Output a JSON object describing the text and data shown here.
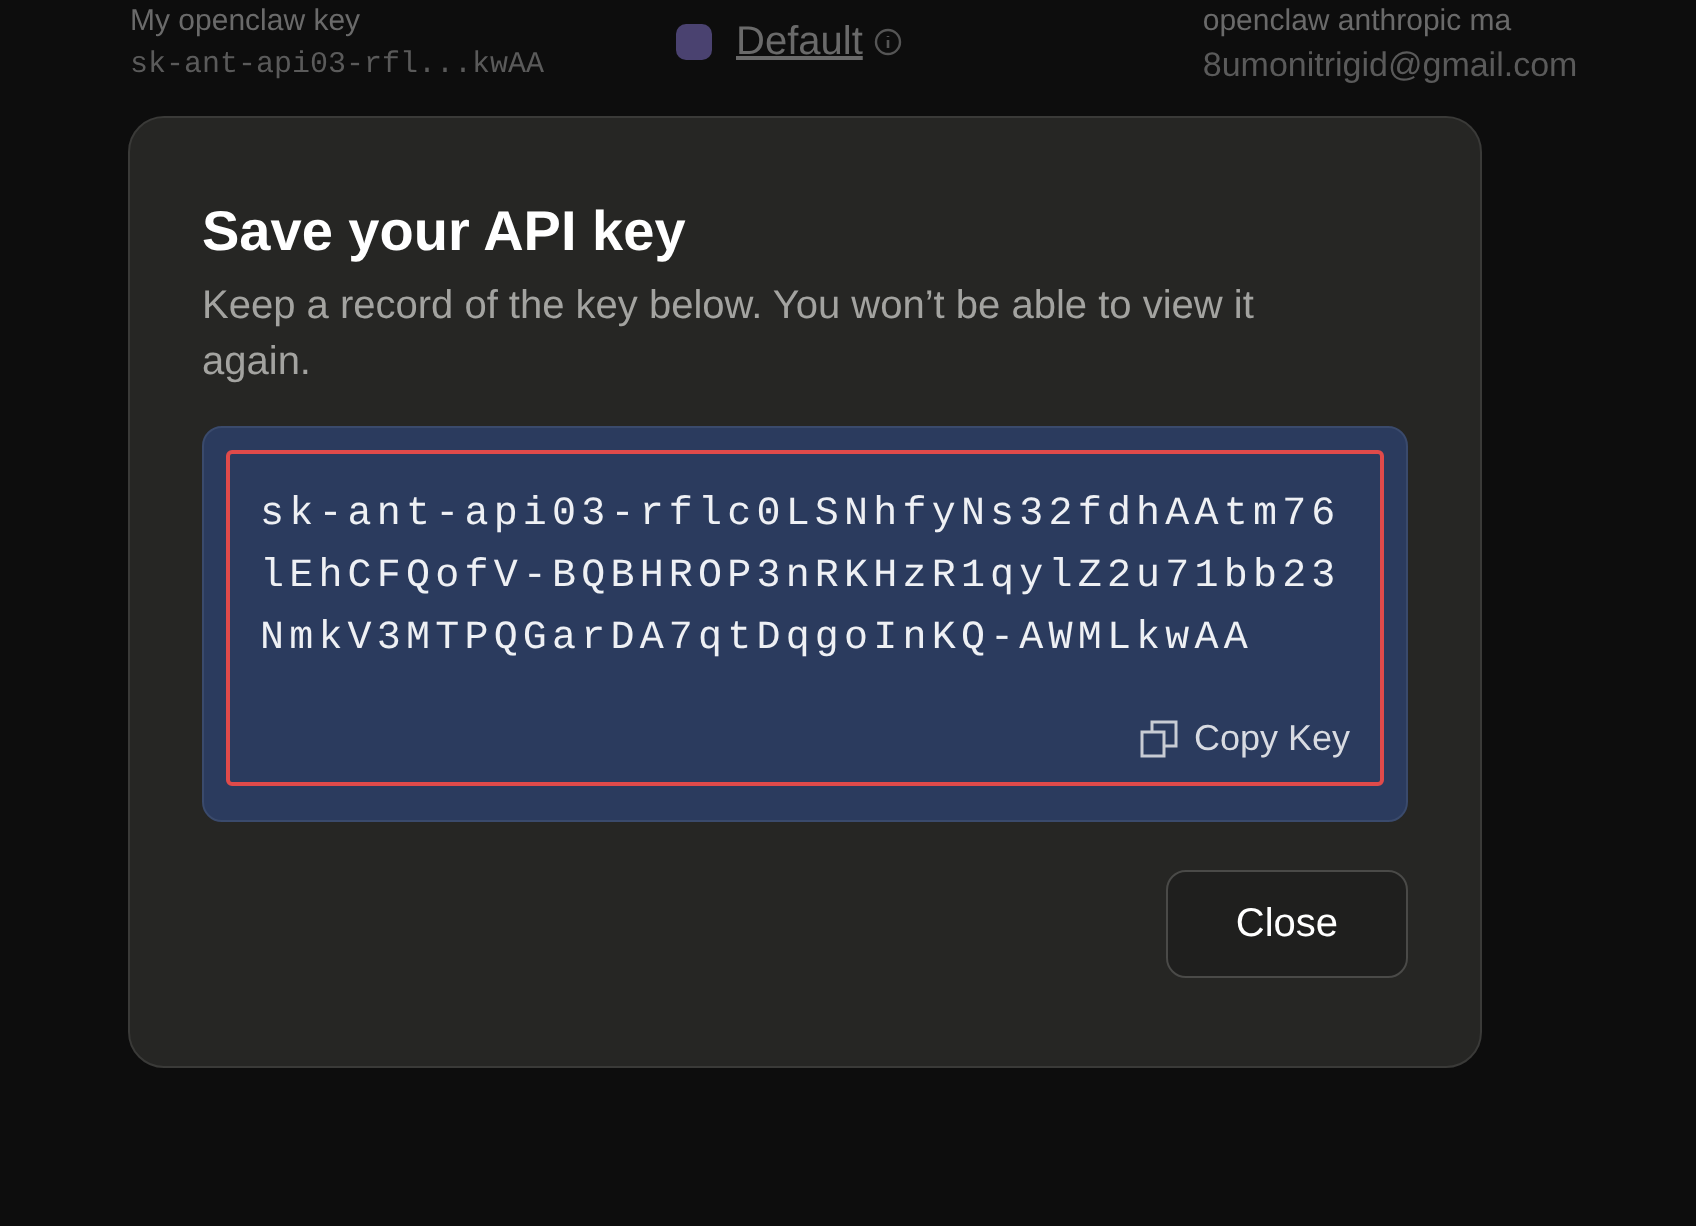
{
  "background_row": {
    "name": "My openclaw key",
    "key": "sk-ant-api03-rfl...kwAA",
    "workspace": "Default",
    "creator_name": "openclaw anthropic ma",
    "creator_email": "8umonitrigid@gmail.com"
  },
  "dialog": {
    "title": "Save your API key",
    "description": "Keep a record of the key below. You won’t be able to view it again.",
    "api_key": "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",
    "copy_label": "Copy Key",
    "close_label": "Close"
  }
}
